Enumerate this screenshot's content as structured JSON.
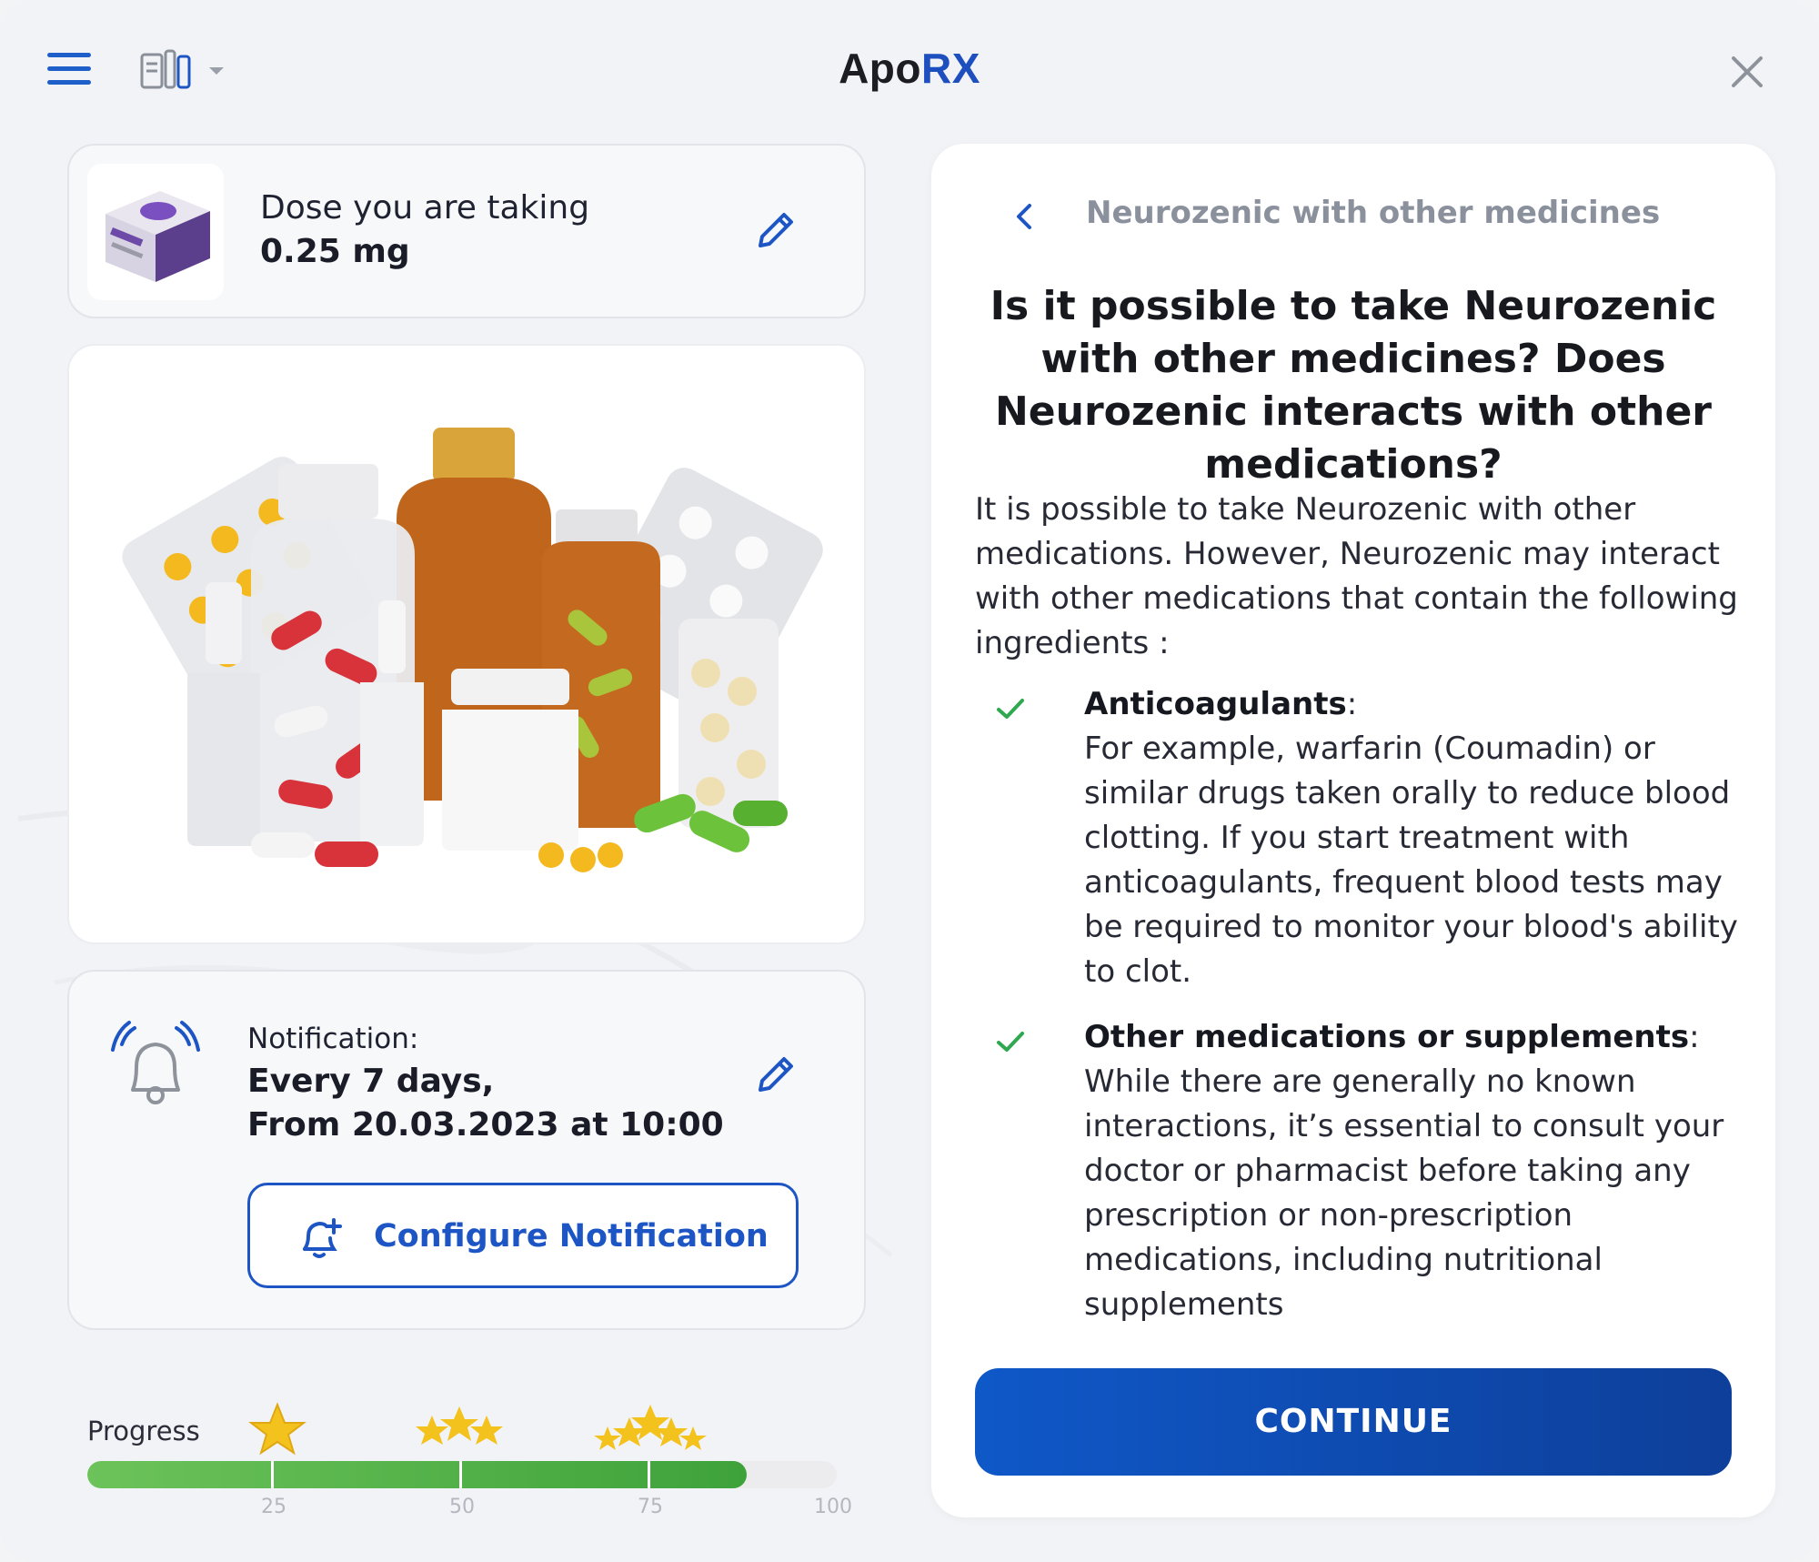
{
  "header": {
    "brand_part1": "Apo",
    "brand_part2": "RX",
    "menu_icon": "hamburger-icon",
    "switch_icon": "app-switch-icon",
    "close_icon": "close-icon"
  },
  "dose": {
    "label": "Dose you are taking",
    "value": "0.25 mg",
    "image_icon": "medicine-box-image",
    "edit_icon": "pencil-icon"
  },
  "illustration": {
    "icon": "medicines-illustration"
  },
  "notification": {
    "label": "Notification:",
    "line1": "Every 7 days,",
    "line2": "From 20.03.2023 at 10:00",
    "configure_label": "Configure Notification",
    "bell_icon": "ringing-bell-icon",
    "add_bell_icon": "add-notification-icon",
    "edit_icon": "pencil-icon"
  },
  "progress": {
    "label": "Progress",
    "percent": 88,
    "ticks": [
      "25",
      "50",
      "75",
      "100"
    ],
    "milestone_stars": [
      1,
      3,
      5
    ]
  },
  "panel": {
    "breadcrumb": "Neurozenic with other medicines",
    "title": "Is it possible to take Neurozenic with other medicines? Does Neurozenic interacts with other medications?",
    "intro": "It is possible to take Neurozenic with other medications. However, Neurozenic may interact with other medications that contain the following ingredients :",
    "items": [
      {
        "heading": "Anticoagulants",
        "text": "For example, warfarin (Coumadin) or similar drugs taken orally to reduce blood clotting. If you start treatment with anticoagulants, frequent blood tests may be required to monitor your blood's ability to clot."
      },
      {
        "heading": "Other medications or supplements",
        "text": "While there are generally no known interactions, it’s essential to consult your doctor or pharmacist before taking any prescription or non-prescription medications, including nutritional supplements"
      }
    ],
    "continue_label": "CONTINUE",
    "back_icon": "chevron-left-icon",
    "check_icon": "check-icon"
  },
  "colors": {
    "accent": "#1d56c4",
    "brand_blue": "#1d4fbf",
    "check_green": "#2fa84f",
    "progress_green": "#4caf45"
  }
}
